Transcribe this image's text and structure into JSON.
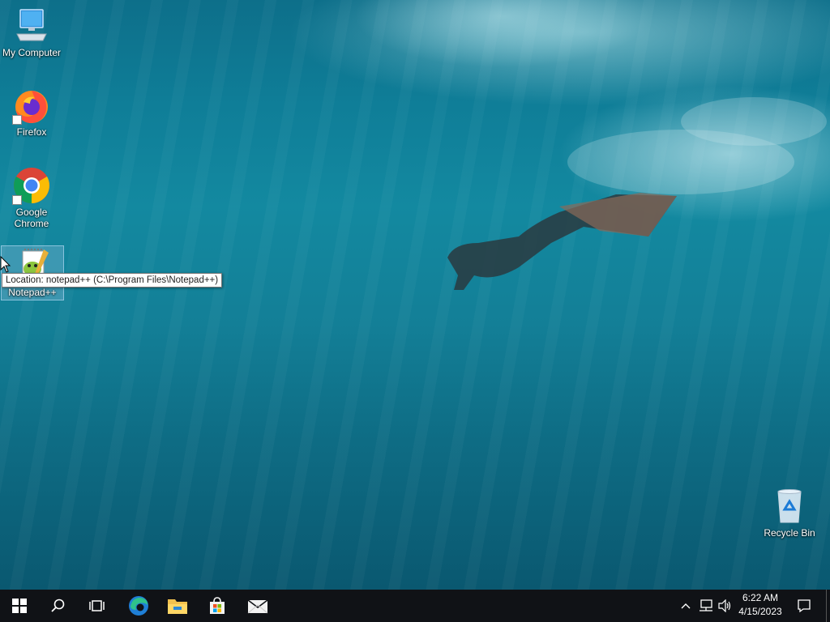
{
  "desktop": {
    "icons": [
      {
        "label": "My Computer",
        "icon": "computer-icon"
      },
      {
        "label": "Firefox",
        "icon": "firefox-icon"
      },
      {
        "label": "Google Chrome",
        "icon": "chrome-icon"
      },
      {
        "label": "Notepad++",
        "icon": "notepad-plus-plus-icon"
      },
      {
        "label": "Recycle Bin",
        "icon": "recycle-bin-icon"
      }
    ],
    "tooltip": "Location: notepad++ (C:\\Program Files\\Notepad++)"
  },
  "taskbar": {
    "start": "start-icon",
    "search": "search-icon",
    "task_view": "task-view-icon",
    "pinned": [
      "edge-icon",
      "file-explorer-icon",
      "store-icon",
      "mail-icon"
    ],
    "tray": [
      "chevron-up-icon",
      "network-icon",
      "volume-icon"
    ],
    "clock": {
      "time": "6:22 AM",
      "date": "4/15/2023"
    },
    "notifications": "notification-icon"
  },
  "colors": {
    "taskbar_bg": "#101216",
    "water": "#1389a0",
    "selection": "#a0c8e6"
  }
}
